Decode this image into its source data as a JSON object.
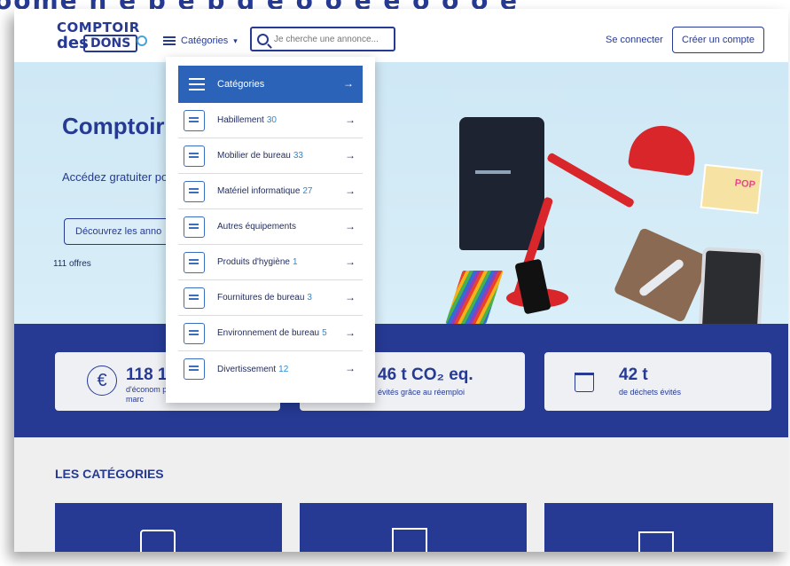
{
  "banner": {
    "text": "oome n e p e p  q e o   o   e e  o   o o   e   "
  },
  "header": {
    "logo_line1": "COMPTOIR",
    "logo_line2": "des",
    "logo_line3": "DONS",
    "categories_label": "Catégories",
    "search_placeholder": "Je cherche une annonce...",
    "login": "Se connecter",
    "signup": "Créer un compte"
  },
  "hero": {
    "title": "Comptoir              orme de dons c",
    "subtitle": "Accédez gratuiter                                        pour booster vos proje",
    "cta": "Découvrez les anno",
    "offers": "111 offres",
    "poster_text": "POP"
  },
  "stats": [
    {
      "big": "118 1",
      "small": "d'économ prix marc"
    },
    {
      "big": "46 t CO₂ eq.",
      "small": "évités grâce au réemploi"
    },
    {
      "big": "42 t",
      "small": "de déchets évités"
    }
  ],
  "categories_section": {
    "title": "LES CATÉGORIES"
  },
  "menu": {
    "header": "Catégories",
    "items": [
      {
        "label": "Habillement",
        "count": "30",
        "icon": "clothing-icon"
      },
      {
        "label": "Mobilier de bureau",
        "count": "33",
        "icon": "desk-icon"
      },
      {
        "label": "Matériel informatique",
        "count": "27",
        "icon": "printer-icon"
      },
      {
        "label": "Autres équipements",
        "count": "",
        "icon": "bed-icon"
      },
      {
        "label": "Produits d'hygiène",
        "count": "1",
        "icon": "hygiene-icon"
      },
      {
        "label": "Fournitures de bureau",
        "count": "3",
        "icon": "binders-icon"
      },
      {
        "label": "Environnement de bureau",
        "count": "5",
        "icon": "calendar-icon"
      },
      {
        "label": "Divertissement",
        "count": "12",
        "icon": "book-icon"
      }
    ]
  },
  "colors": {
    "primary": "#263a94",
    "accent": "#2a63b7",
    "count": "#2a8ad6",
    "hero_bg": "#cfe8f5"
  }
}
